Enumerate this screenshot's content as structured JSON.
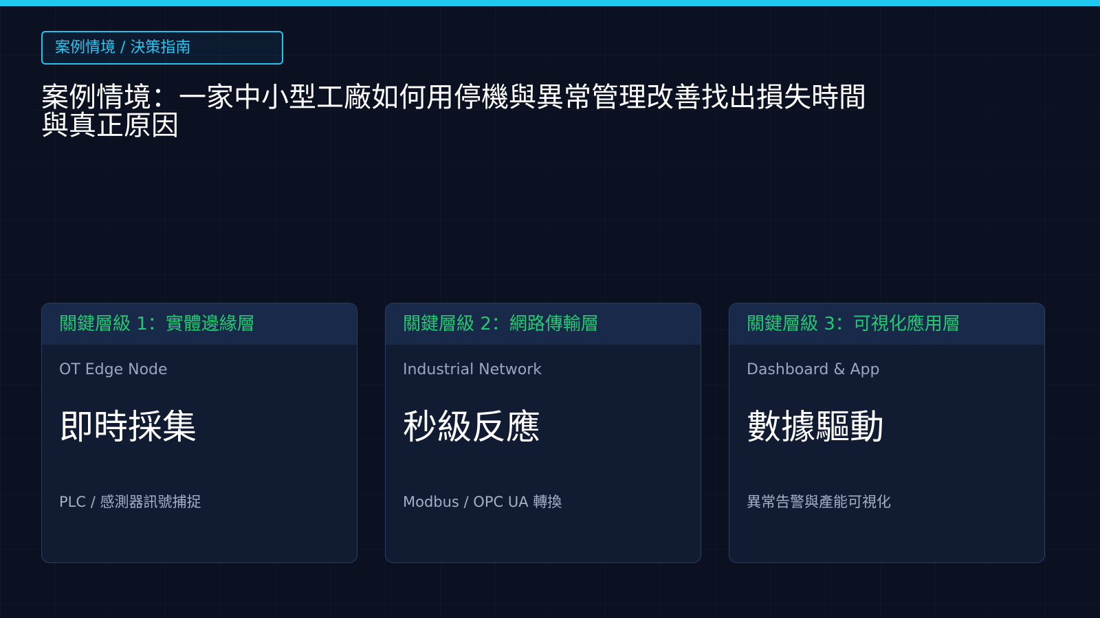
{
  "colors": {
    "background": "#0b1120",
    "accent": "#1ec8f0",
    "card_bg": "#111c33",
    "card_header_bg": "#19294a",
    "header_text": "#24c971"
  },
  "tag": {
    "label": "案例情境 / 決策指南"
  },
  "title": "案例情境：一家中小型工廠如何用停機與異常管理改善找出損失時間與真正原因",
  "cards": [
    {
      "header": "關鍵層級 1：實體邊緣層",
      "subtitle": "OT Edge Node",
      "main": "即時採集",
      "description": "PLC / 感測器訊號捕捉"
    },
    {
      "header": "關鍵層級 2：網路傳輸層",
      "subtitle": "Industrial Network",
      "main": "秒級反應",
      "description": "Modbus / OPC UA 轉換"
    },
    {
      "header": "關鍵層級 3：可視化應用層",
      "subtitle": "Dashboard & App",
      "main": "數據驅動",
      "description": "異常告警與產能可視化"
    }
  ]
}
